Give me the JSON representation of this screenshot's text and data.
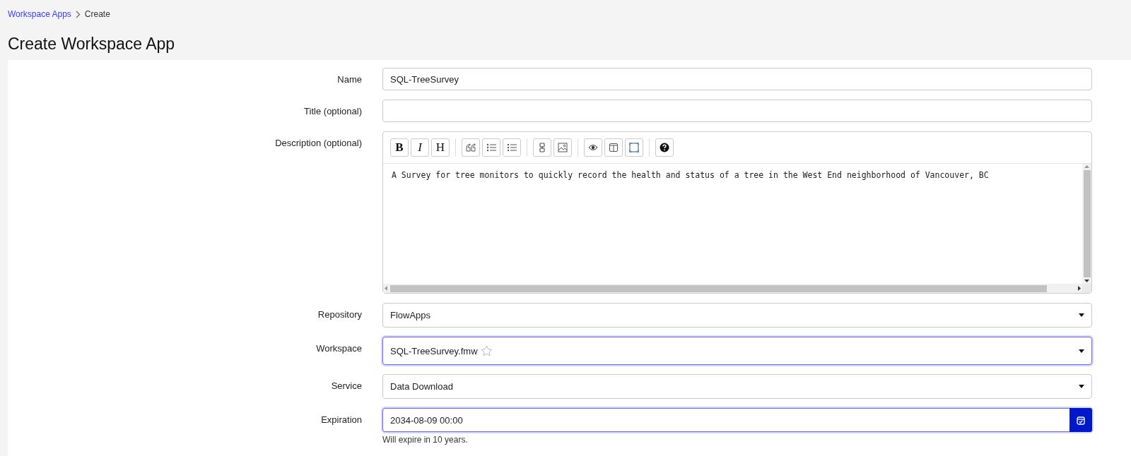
{
  "breadcrumb": [
    {
      "label": "Workspace Apps",
      "kind": "link"
    },
    {
      "label": "Create",
      "kind": "current"
    }
  ],
  "title": "Create Workspace App",
  "fields": [
    {
      "kind": "text",
      "label": "Name",
      "value": "SQL-TreeSurvey",
      "focused": false
    },
    {
      "kind": "text",
      "label": "Title (optional)",
      "focused": false
    },
    {
      "kind": "editor",
      "label": "Description (optional)",
      "toolbar_letters": [
        "B",
        "I",
        "H"
      ],
      "value": "A Survey for tree monitors to quickly record the health and status of a tree in the West End neighborhood of Vancouver, BC",
      "focused": false
    },
    {
      "kind": "select",
      "label": "Repository",
      "value": "FlowApps",
      "focused": false
    },
    {
      "kind": "select",
      "label": "Workspace",
      "value": "SQL-TreeSurvey.fmw",
      "favorite": false,
      "focused": true
    },
    {
      "kind": "select",
      "label": "Service",
      "value": "Data Download",
      "focused": false
    },
    {
      "kind": "date",
      "label": "Expiration",
      "value": "2034-08-09 00:00",
      "hint": "Will expire in 10 years.",
      "focused": true
    }
  ]
}
